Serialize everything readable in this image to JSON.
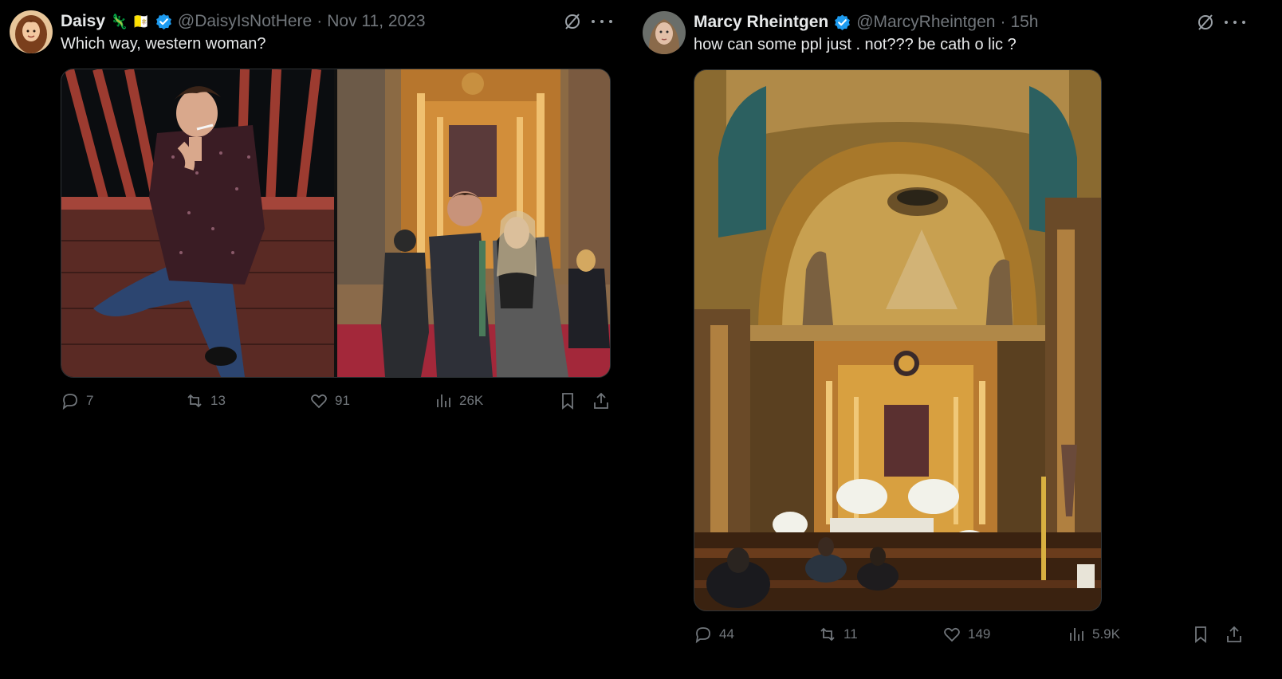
{
  "tweets": [
    {
      "name": "Daisy",
      "emojis": "🦎 🇻🇦",
      "handle": "@DaisyIsNotHere",
      "separator": "·",
      "time": "Nov 11, 2023",
      "text": "Which way, western woman?",
      "stats": {
        "replies": "7",
        "reposts": "13",
        "likes": "91",
        "views": "26K"
      },
      "media": [
        "man-smoking-on-deck-photo",
        "couple-in-church-photo"
      ]
    },
    {
      "name": "Marcy Rheintgen",
      "handle": "@MarcyRheintgen",
      "separator": "·",
      "time": "15h",
      "text": "how can some ppl just . not??? be cath o lic ?",
      "stats": {
        "replies": "44",
        "reposts": "11",
        "likes": "149",
        "views": "5.9K"
      },
      "media": [
        "church-altar-interior-photo"
      ]
    }
  ],
  "colors": {
    "background": "#000000",
    "text": "#e7e9ea",
    "muted": "#71767b",
    "verified": "#1d9bf0"
  },
  "icons": [
    "grok-icon",
    "more-icon",
    "reply-icon",
    "repost-icon",
    "like-icon",
    "views-icon",
    "bookmark-icon",
    "share-icon",
    "verified-badge-icon"
  ]
}
